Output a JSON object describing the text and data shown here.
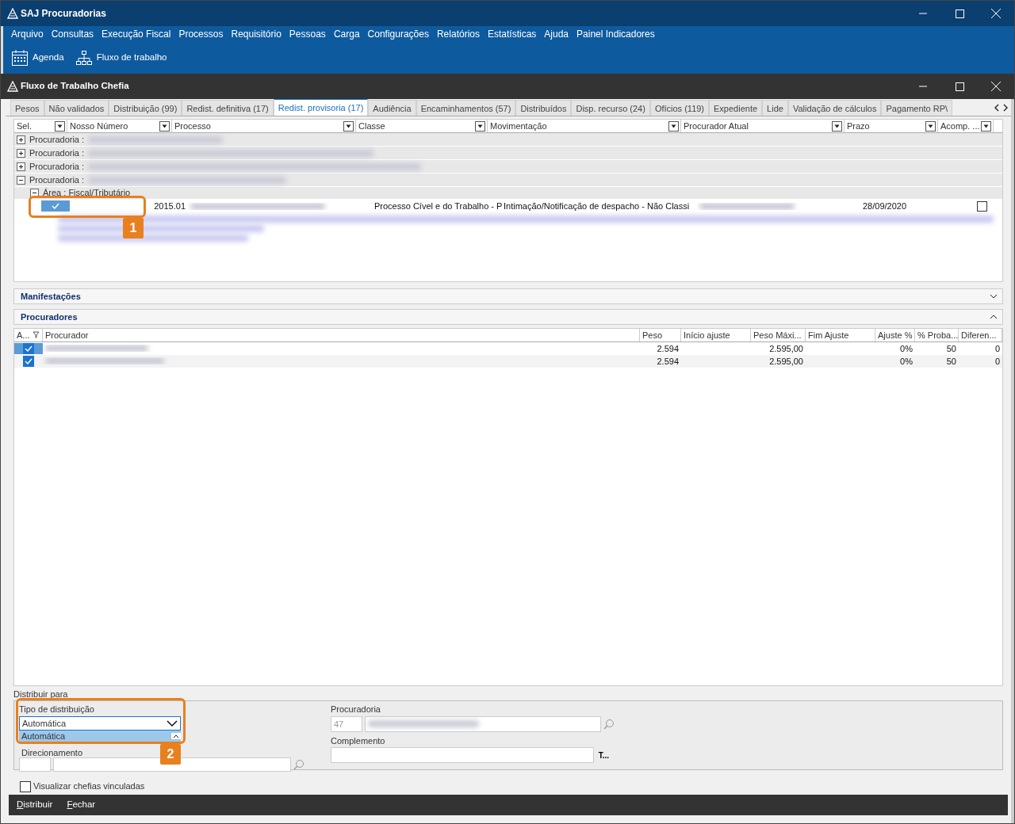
{
  "app": {
    "title": "SAJ Procuradorias"
  },
  "menu": [
    "Arquivo",
    "Consultas",
    "Execução Fiscal",
    "Processos",
    "Requisitório",
    "Pessoas",
    "Carga",
    "Configurações",
    "Relatórios",
    "Estatísticas",
    "Ajuda",
    "Painel Indicadores"
  ],
  "toolbar": [
    {
      "kind": "calendar",
      "label": "Agenda"
    },
    {
      "kind": "flow",
      "label": "Fluxo de trabalho"
    }
  ],
  "window": {
    "title": "Fluxo de Trabalho Chefia"
  },
  "tabs": [
    {
      "label": "Pesos",
      "selected": false
    },
    {
      "label": "Não validados",
      "selected": false
    },
    {
      "label": "Distribuição (99)",
      "selected": false
    },
    {
      "label": "Redist. definitiva (17)",
      "selected": false
    },
    {
      "label": "Redist. provisoria (17)",
      "selected": true
    },
    {
      "label": "Audiência",
      "selected": false
    },
    {
      "label": "Encaminhamentos (57)",
      "selected": false
    },
    {
      "label": "Distribuídos",
      "selected": false
    },
    {
      "label": "Disp. recurso (24)",
      "selected": false
    },
    {
      "label": "Ofícios (119)",
      "selected": false
    },
    {
      "label": "Expediente",
      "selected": false
    },
    {
      "label": "Lide",
      "selected": false
    },
    {
      "label": "Validação de cálculos",
      "selected": false
    },
    {
      "label": "Pagamento RP\\",
      "selected": false
    }
  ],
  "grid": {
    "columns": [
      "Sel.",
      "Nosso Número",
      "Processo",
      "Classe",
      "Movimentação",
      "Procurador Atual",
      "Prazo",
      "Acomp. ..."
    ],
    "groups": [
      {
        "label": "Procuradoria :",
        "expanded": false
      },
      {
        "label": "Procuradoria :",
        "expanded": false
      },
      {
        "label": "Procuradoria :",
        "expanded": false
      },
      {
        "label": "Procuradoria :",
        "expanded": true,
        "children": [
          {
            "label": "Área : Fiscal/Tributário",
            "expanded": true,
            "rows": [
              {
                "selected": true,
                "nosso_numero": "2015.01",
                "classe": "Processo Cível e do Trabalho - P",
                "movimentacao": "Intimação/Notificação de despacho - Não Classi",
                "prazo": "28/09/2020",
                "acomp": false
              }
            ]
          }
        ]
      }
    ]
  },
  "sections": [
    {
      "title": "Manifestações",
      "expanded": false
    },
    {
      "title": "Procuradores",
      "expanded": true
    }
  ],
  "procuradores": {
    "columns": [
      "A...",
      "Procurador",
      "Peso",
      "Início ajuste",
      "Peso Máxi...",
      "Fim Ajuste",
      "Ajuste %",
      "% Proba...",
      "Diferen..."
    ],
    "rows": [
      {
        "checked": true,
        "selected": true,
        "peso": "2.594",
        "peso_max": "2.595,00",
        "ajuste": "0%",
        "proba": "50",
        "diferenca": "0"
      },
      {
        "checked": true,
        "selected": false,
        "peso": "2.594",
        "peso_max": "2.595,00",
        "ajuste": "0%",
        "proba": "50",
        "diferenca": "0"
      }
    ]
  },
  "distribuir": {
    "title": "Distribuir para",
    "tipo_label": "Tipo de distribuição",
    "tipo_value": "Automática",
    "dropdown_option": "Automática",
    "hidden_label": "Direcionamento",
    "procuradoria_label": "Procuradoria",
    "procuradoria_code": "47",
    "complemento_label": "Complemento",
    "t_button": "T..."
  },
  "visualizar": {
    "label": "Visualizar chefias vinculadas",
    "checked": false
  },
  "buttons": [
    "Distribuir",
    "Fechar"
  ],
  "callouts": [
    "1",
    "2"
  ]
}
